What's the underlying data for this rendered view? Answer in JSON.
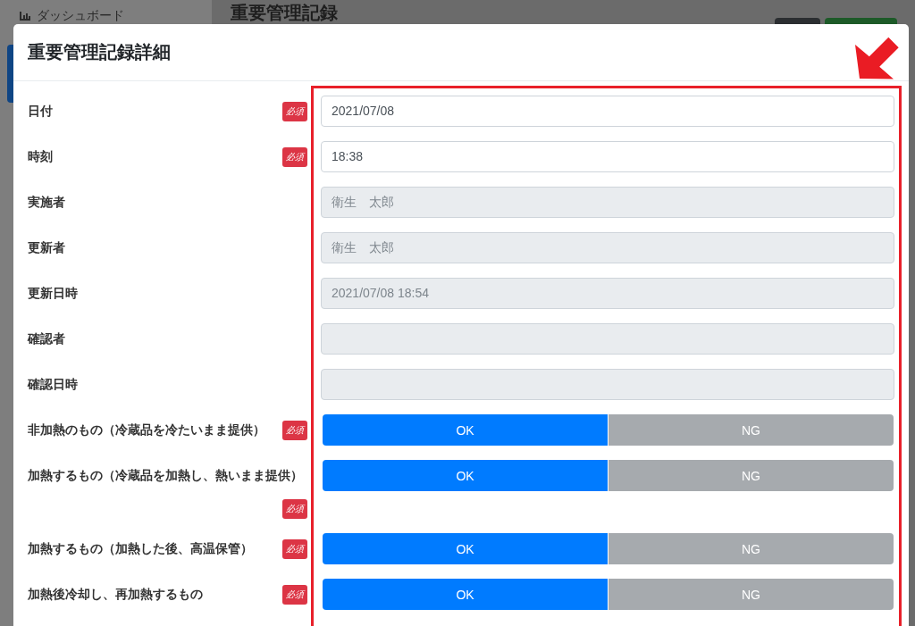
{
  "background": {
    "sidebar_items": [
      {
        "label": "ダッシュボード"
      }
    ],
    "page_title": "重要管理記録"
  },
  "modal": {
    "title": "重要管理記録詳細",
    "fields": [
      {
        "kind": "text",
        "label": "日付",
        "badge": "必須",
        "value": "2021/07/08",
        "disabled": false
      },
      {
        "kind": "text",
        "label": "時刻",
        "badge": "必須",
        "value": "18:38",
        "disabled": false
      },
      {
        "kind": "text",
        "label": "実施者",
        "value": "衛生　太郎",
        "disabled": true
      },
      {
        "kind": "text",
        "label": "更新者",
        "value": "衛生　太郎",
        "disabled": true
      },
      {
        "kind": "text",
        "label": "更新日時",
        "value": "2021/07/08 18:54",
        "disabled": true
      },
      {
        "kind": "text",
        "label": "確認者",
        "disabled": true
      },
      {
        "kind": "text",
        "label": "確認日時",
        "disabled": true
      },
      {
        "kind": "choice",
        "label": "非加熱のもの（冷蔵品を冷たいまま提供）",
        "badge": "必須",
        "options": [
          {
            "label": "OK",
            "selected": true
          },
          {
            "label": "NG",
            "selected": false
          }
        ]
      },
      {
        "kind": "choice",
        "label": "加熱するもの（冷蔵品を加熱し、熱いまま提供）",
        "badge": "必須",
        "options": [
          {
            "label": "OK",
            "selected": true
          },
          {
            "label": "NG",
            "selected": false
          }
        ]
      },
      {
        "kind": "choice",
        "label": "加熱するもの（加熱した後、高温保管）",
        "badge": "必須",
        "options": [
          {
            "label": "OK",
            "selected": true
          },
          {
            "label": "NG",
            "selected": false
          }
        ]
      },
      {
        "kind": "choice",
        "label": "加熱後冷却し、再加熱するもの",
        "badge": "必須",
        "options": [
          {
            "label": "OK",
            "selected": true
          },
          {
            "label": "NG",
            "selected": false
          }
        ]
      }
    ]
  }
}
